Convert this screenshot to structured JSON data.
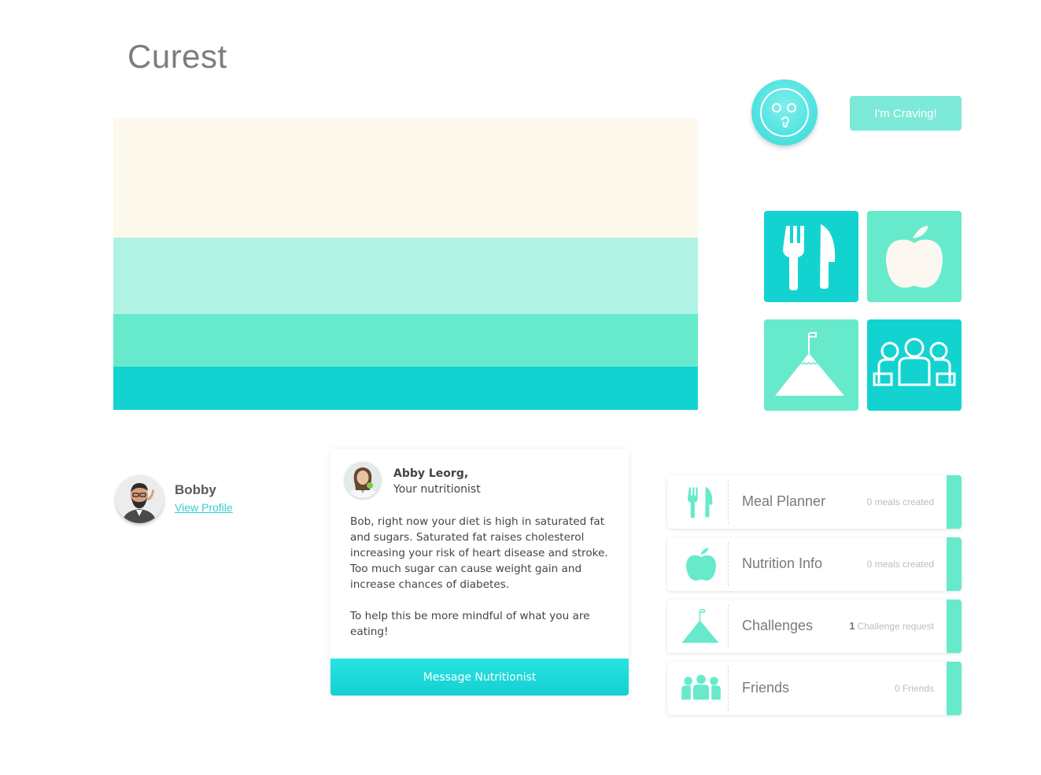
{
  "app": {
    "title": "Curest"
  },
  "craving": {
    "button_label": "I'm Craving!"
  },
  "tiles": [
    {
      "name": "meal-planner",
      "icon": "fork-knife-icon"
    },
    {
      "name": "nutrition",
      "icon": "apple-icon"
    },
    {
      "name": "challenges",
      "icon": "mountain-flag-icon"
    },
    {
      "name": "friends",
      "icon": "group-icon"
    }
  ],
  "profile": {
    "name": "Bobby",
    "link_label": "View Profile"
  },
  "nutritionist": {
    "name": "Abby Leorg,",
    "role": "Your nutritionist",
    "message": [
      "Bob, right now your diet is high in saturated fat and sugars. Saturated fat raises cholesterol increasing your risk of heart disease and stroke. Too much sugar can cause weight gain and increase chances of diabetes.",
      "To help this be more mindful of what you are eating!"
    ],
    "button_label": "Message Nutritionist"
  },
  "features": [
    {
      "label": "Meal Planner",
      "count": "",
      "stat": "0 meals created",
      "icon": "fork-knife-icon"
    },
    {
      "label": "Nutrition Info",
      "count": "",
      "stat": "0 meals created",
      "icon": "apple-icon"
    },
    {
      "label": "Challenges",
      "count": "1",
      "stat": "Challenge request",
      "icon": "mountain-flag-icon"
    },
    {
      "label": "Friends",
      "count": "",
      "stat": "0 Friends",
      "icon": "group-icon"
    }
  ],
  "colors": {
    "cream": "#fcf8ec",
    "mint_light": "#b0f3e4",
    "mint": "#67eacb",
    "teal": "#13d3d1",
    "title_gray": "#7d7d7d"
  }
}
